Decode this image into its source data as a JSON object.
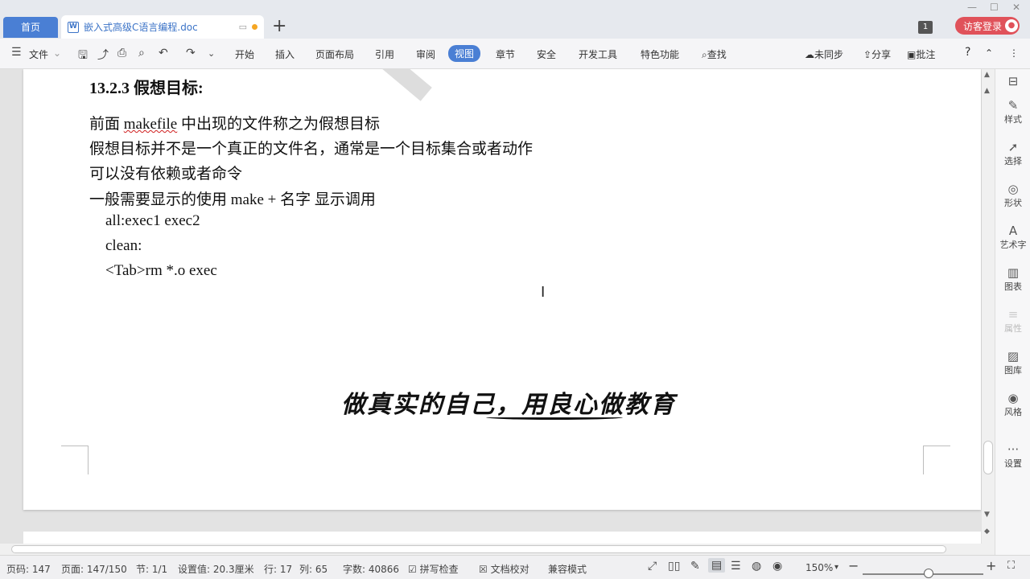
{
  "tabs": {
    "home": "首页",
    "doc_title": "嵌入式高级C语言编程.doc",
    "doc_icon": "W",
    "new_tab": "+"
  },
  "topright": {
    "badge": "1",
    "login": "访客登录"
  },
  "menu": {
    "file": "文件",
    "items": [
      "开始",
      "插入",
      "页面布局",
      "引用",
      "审阅",
      "视图",
      "章节",
      "安全",
      "开发工具",
      "特色功能"
    ],
    "active": "视图",
    "search": "查找",
    "sync": "未同步",
    "share": "分享",
    "comment": "批注"
  },
  "document": {
    "heading": "13.2.3  假想目标:",
    "lines": [
      "前面 makefile 中出现的文件称之为假想目标",
      "假想目标并不是一个真正的文件名，通常是一个目标集合或者动作",
      "可以没有依赖或者命令",
      "一般需要显示的使用 make +  名字  显示调用",
      "all:exec1 exec2",
      "clean:",
      "<Tab>rm *.o exec"
    ],
    "line1_pre": "前面 ",
    "line1_word": "makefile",
    "line1_post": " 中出现的文件称之为假想目标",
    "slogan": "做真实的自己，用良心做教育"
  },
  "sidebar": {
    "items": [
      "样式",
      "选择",
      "形状",
      "艺术字",
      "图表",
      "属性",
      "图库",
      "风格",
      "设置"
    ]
  },
  "status": {
    "page": "页码: 147",
    "pages": "页面: 147/150",
    "section": "节: 1/1",
    "setting": "设置值: 20.3厘米",
    "row": "行: 17",
    "col": "列: 65",
    "words": "字数: 40866",
    "spell": "拼写检查",
    "proof": "文档校对",
    "compat": "兼容模式",
    "zoom": "150%"
  },
  "colors": {
    "accent": "#4a7fd4",
    "login": "#e0525a"
  }
}
